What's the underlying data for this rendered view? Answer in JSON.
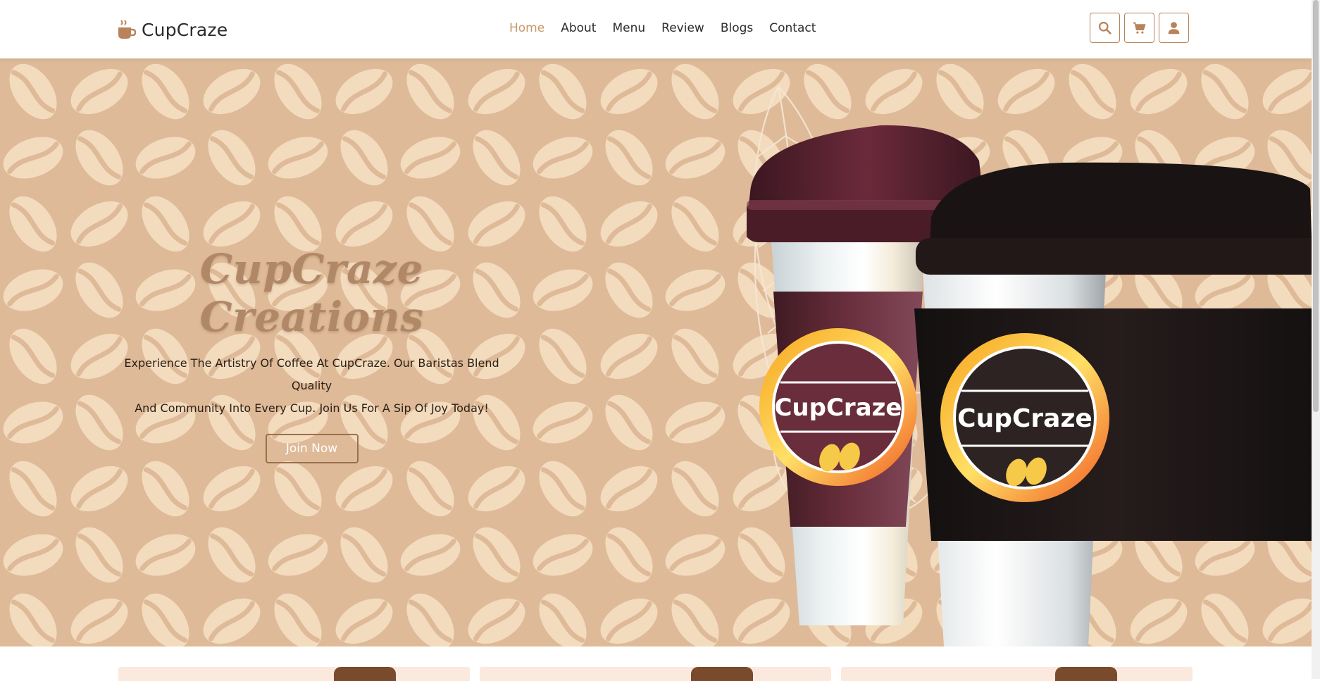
{
  "brand": {
    "name": "CupCraze",
    "icon": "coffee-cup-icon"
  },
  "nav": {
    "items": [
      {
        "label": "Home",
        "active": true
      },
      {
        "label": "About",
        "active": false
      },
      {
        "label": "Menu",
        "active": false
      },
      {
        "label": "Review",
        "active": false
      },
      {
        "label": "Blogs",
        "active": false
      },
      {
        "label": "Contact",
        "active": false
      }
    ]
  },
  "actions": {
    "search_icon": "search-icon",
    "cart_icon": "cart-icon",
    "user_icon": "user-icon"
  },
  "hero": {
    "title": "CupCraze Creations",
    "description_line1": "Experience The Artistry Of Coffee At CupCraze. Our Baristas Blend Quality",
    "description_line2": "And Community Into Every Cup. Join Us For A Sip Of Joy Today!",
    "cta_label": "Join Now",
    "cup_brand_1": "CupCraze",
    "cup_brand_2": "CupCraze"
  },
  "colors": {
    "accent": "#c49a6c",
    "hero_bg": "#deba98",
    "bean": "#f3dbbe",
    "cup_maroon": "#5e2a36",
    "cup_black": "#1c1414"
  }
}
